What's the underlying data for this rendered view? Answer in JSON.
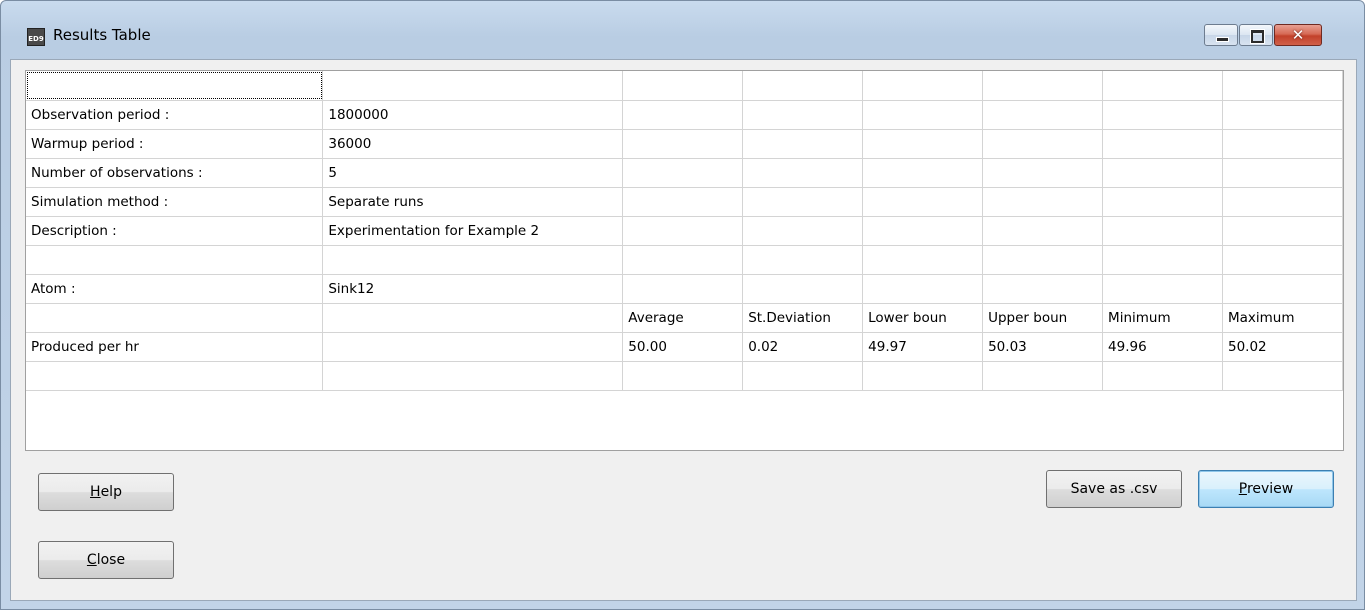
{
  "window": {
    "title": "Results Table",
    "app_icon_text": "ED9",
    "close_glyph": "✕"
  },
  "table": {
    "rows": [
      [
        "",
        "",
        "",
        "",
        "",
        "",
        "",
        ""
      ],
      [
        "Observation period :",
        "1800000",
        "",
        "",
        "",
        "",
        "",
        ""
      ],
      [
        "Warmup period :",
        "36000",
        "",
        "",
        "",
        "",
        "",
        ""
      ],
      [
        "Number of observations :",
        "5",
        "",
        "",
        "",
        "",
        "",
        ""
      ],
      [
        "Simulation method :",
        "Separate runs",
        "",
        "",
        "",
        "",
        "",
        ""
      ],
      [
        "Description :",
        "Experimentation for Example 2",
        "",
        "",
        "",
        "",
        "",
        ""
      ],
      [
        "",
        "",
        "",
        "",
        "",
        "",
        "",
        ""
      ],
      [
        "Atom :",
        "Sink12",
        "",
        "",
        "",
        "",
        "",
        ""
      ],
      [
        "",
        "",
        "Average",
        "St.Deviation",
        "Lower boun",
        "Upper boun",
        "Minimum",
        "Maximum"
      ],
      [
        "Produced per hr",
        "",
        "50.00",
        "0.02",
        "49.97",
        "50.03",
        "49.96",
        "50.02"
      ],
      [
        "",
        "",
        "",
        "",
        "",
        "",
        "",
        ""
      ]
    ]
  },
  "buttons": {
    "help": {
      "mnemonic": "H",
      "rest": "elp"
    },
    "close": {
      "mnemonic": "C",
      "rest": "lose"
    },
    "save_csv": "Save as .csv",
    "preview": {
      "mnemonic": "P",
      "rest": "review"
    }
  }
}
